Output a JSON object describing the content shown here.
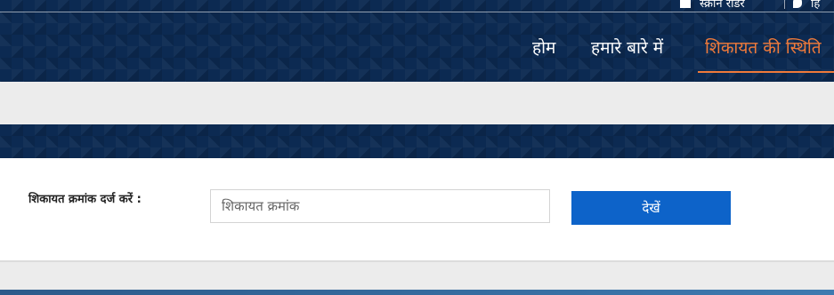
{
  "topbar": {
    "item1_label": "स्क्रीन रीडर",
    "item2_label": "हि"
  },
  "nav": {
    "items": [
      {
        "label": "होम"
      },
      {
        "label": "हमारे बारे में"
      },
      {
        "label": "शिकायत की स्थिति"
      }
    ],
    "active_index": 2
  },
  "form": {
    "label": "शिकायत क्रमांक दर्ज करें :",
    "input_placeholder": "शिकायत क्रमांक",
    "input_value": "",
    "button_label": "देखें"
  },
  "colors": {
    "header_bg": "#0c2a52",
    "nav_active": "#f07a3a",
    "button_bg": "#0d63c9"
  }
}
